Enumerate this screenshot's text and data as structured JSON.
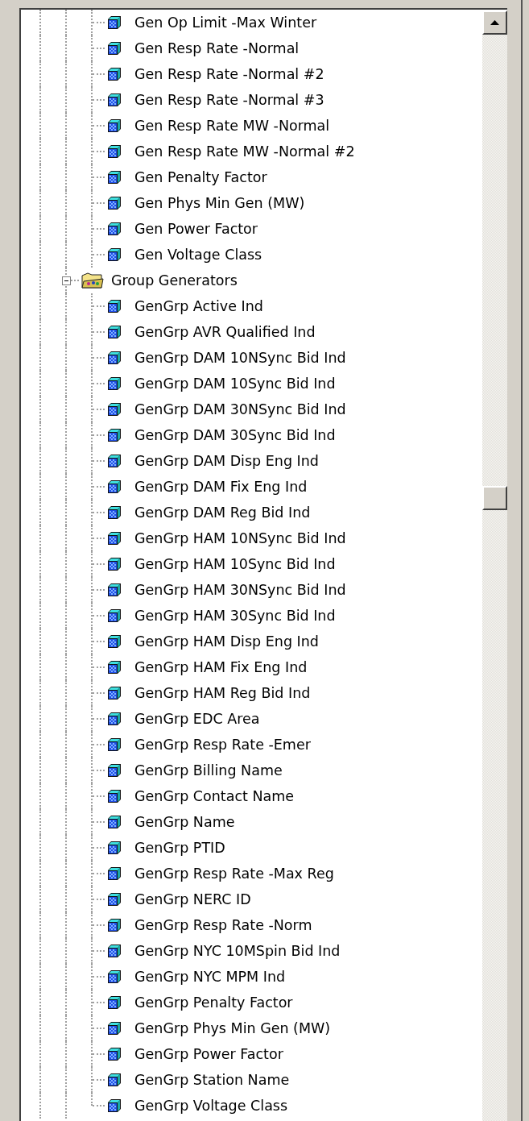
{
  "tree": {
    "continued_items": [
      {
        "label": "Gen Op Limit -Max Winter"
      },
      {
        "label": "Gen Resp Rate -Normal"
      },
      {
        "label": "Gen Resp Rate -Normal #2"
      },
      {
        "label": "Gen Resp Rate -Normal #3"
      },
      {
        "label": "Gen Resp Rate MW -Normal"
      },
      {
        "label": "Gen Resp Rate MW -Normal #2"
      },
      {
        "label": "Gen Penalty Factor"
      },
      {
        "label": "Gen Phys Min Gen (MW)"
      },
      {
        "label": "Gen Power Factor"
      },
      {
        "label": "Gen Voltage Class"
      }
    ],
    "groups": [
      {
        "label": "Group Generators",
        "expanded": true,
        "children": [
          {
            "label": "GenGrp Active Ind"
          },
          {
            "label": "GenGrp AVR Qualified Ind"
          },
          {
            "label": "GenGrp DAM 10NSync Bid Ind"
          },
          {
            "label": "GenGrp DAM 10Sync Bid Ind"
          },
          {
            "label": "GenGrp DAM 30NSync Bid Ind"
          },
          {
            "label": "GenGrp DAM 30Sync Bid Ind"
          },
          {
            "label": "GenGrp DAM Disp Eng Ind"
          },
          {
            "label": "GenGrp DAM Fix Eng Ind"
          },
          {
            "label": "GenGrp DAM Reg Bid Ind"
          },
          {
            "label": "GenGrp HAM 10NSync Bid Ind"
          },
          {
            "label": "GenGrp HAM 10Sync Bid Ind"
          },
          {
            "label": "GenGrp HAM 30NSync Bid Ind"
          },
          {
            "label": "GenGrp HAM 30Sync Bid Ind"
          },
          {
            "label": "GenGrp HAM Disp Eng Ind"
          },
          {
            "label": "GenGrp HAM Fix Eng Ind"
          },
          {
            "label": "GenGrp HAM Reg Bid Ind"
          },
          {
            "label": "GenGrp EDC Area"
          },
          {
            "label": "GenGrp Resp Rate -Emer"
          },
          {
            "label": "GenGrp Billing Name"
          },
          {
            "label": "GenGrp Contact Name"
          },
          {
            "label": "GenGrp Name"
          },
          {
            "label": "GenGrp PTID"
          },
          {
            "label": "GenGrp Resp Rate -Max Reg"
          },
          {
            "label": "GenGrp NERC ID"
          },
          {
            "label": "GenGrp Resp Rate -Norm"
          },
          {
            "label": "GenGrp NYC 10MSpin Bid Ind"
          },
          {
            "label": "GenGrp NYC MPM Ind"
          },
          {
            "label": "GenGrp Penalty Factor"
          },
          {
            "label": "GenGrp Phys Min Gen (MW)"
          },
          {
            "label": "GenGrp Power Factor"
          },
          {
            "label": "GenGrp Station Name"
          },
          {
            "label": "GenGrp Voltage Class"
          }
        ]
      }
    ]
  }
}
